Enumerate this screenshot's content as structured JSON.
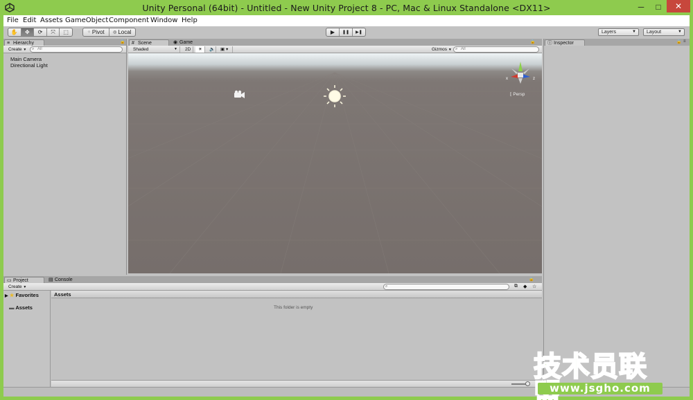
{
  "window": {
    "title": "Unity Personal (64bit) - Untitled - New Unity Project 8 - PC, Mac & Linux Standalone <DX11>",
    "minimize": "─",
    "maximize": "□",
    "close": "✕"
  },
  "menu": [
    "File",
    "Edit",
    "Assets",
    "GameObject",
    "Component",
    "Window",
    "Help"
  ],
  "toolbar": {
    "tools": [
      "hand-icon",
      "move-icon",
      "rotate-icon",
      "scale-icon",
      "rect-icon"
    ],
    "tool_glyphs": [
      "✋",
      "✥",
      "⟳",
      "⤧",
      "⬚"
    ],
    "active_tool": 1,
    "pivot_label": "Pivot",
    "local_label": "Local",
    "play_glyphs": [
      "▶",
      "❚❚",
      "▶❚"
    ],
    "layers_label": "Layers",
    "layout_label": "Layout"
  },
  "hierarchy": {
    "tab_label": "Hierarchy",
    "create_label": "Create",
    "search_placeholder": "All",
    "items": [
      "Main Camera",
      "Directional Light"
    ]
  },
  "scene": {
    "tabs": [
      "Scene",
      "Game"
    ],
    "shaded_label": "Shaded",
    "mode_2d": "2D",
    "gizmos_label": "Gizmos",
    "search_placeholder": "All",
    "persp_label": "Persp",
    "axis_x": "x",
    "axis_z": "z"
  },
  "inspector": {
    "tab_label": "Inspector"
  },
  "project": {
    "tabs": [
      "Project",
      "Console"
    ],
    "create_label": "Create",
    "favorites_label": "Favorites",
    "assets_label": "Assets",
    "assets_header": "Assets",
    "empty_text": "This folder is empty"
  },
  "watermark": {
    "cn_text": "技术员联盟",
    "url_text": "www.jsgho.com"
  }
}
